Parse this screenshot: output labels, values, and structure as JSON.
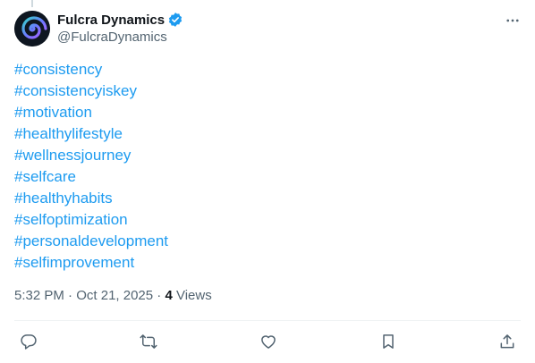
{
  "author": {
    "display_name": "Fulcra Dynamics",
    "handle": "@FulcraDynamics",
    "verified": true
  },
  "hashtags": [
    "#consistency",
    "#consistencyiskey",
    "#motivation",
    "#healthylifestyle",
    "#wellnessjourney",
    "#selfcare",
    "#healthyhabits",
    "#selfoptimization",
    "#personaldevelopment",
    "#selfimprovement"
  ],
  "meta": {
    "time": "5:32 PM",
    "separator": " · ",
    "date": "Oct 21, 2025",
    "views_count": "4",
    "views_label": "Views"
  },
  "colors": {
    "link": "#1d9bf0",
    "secondary_text": "#536471",
    "primary_text": "#0f1419",
    "verified": "#1d9bf0"
  },
  "icons": {
    "avatar": "spiral-logo",
    "more": "more-dots-icon",
    "reply": "reply-icon",
    "repost": "repost-icon",
    "like": "like-icon",
    "bookmark": "bookmark-icon",
    "share": "share-icon"
  }
}
